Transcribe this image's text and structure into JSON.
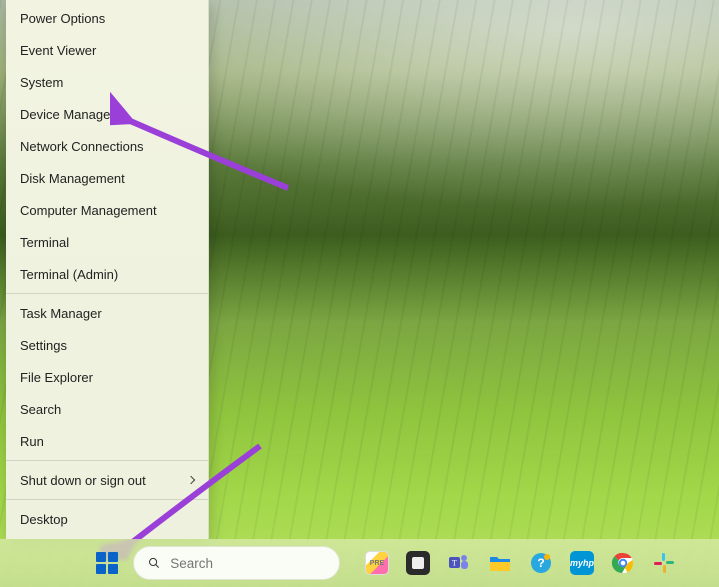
{
  "colors": {
    "accent_purple": "#9b3fd9",
    "start_blue": "#0a63c9"
  },
  "winx_menu": {
    "groups": [
      {
        "items": [
          {
            "key": "power-options",
            "label": "Power Options"
          },
          {
            "key": "event-viewer",
            "label": "Event Viewer"
          },
          {
            "key": "system",
            "label": "System"
          },
          {
            "key": "device-manager",
            "label": "Device Manager"
          },
          {
            "key": "network-connections",
            "label": "Network Connections"
          },
          {
            "key": "disk-management",
            "label": "Disk Management"
          },
          {
            "key": "computer-management",
            "label": "Computer Management"
          },
          {
            "key": "terminal",
            "label": "Terminal"
          },
          {
            "key": "terminal-admin",
            "label": "Terminal (Admin)"
          }
        ]
      },
      {
        "items": [
          {
            "key": "task-manager",
            "label": "Task Manager"
          },
          {
            "key": "settings",
            "label": "Settings"
          },
          {
            "key": "file-explorer",
            "label": "File Explorer"
          },
          {
            "key": "search",
            "label": "Search"
          },
          {
            "key": "run",
            "label": "Run"
          }
        ]
      },
      {
        "items": [
          {
            "key": "shut-down-or-sign-out",
            "label": "Shut down or sign out",
            "submenu": true
          }
        ]
      },
      {
        "items": [
          {
            "key": "desktop",
            "label": "Desktop"
          }
        ]
      }
    ]
  },
  "taskbar": {
    "search_placeholder": "Search",
    "icons": [
      {
        "key": "microsoft-store",
        "name": "microsoft-store-icon"
      },
      {
        "key": "app-dark",
        "name": "app-dark-icon"
      },
      {
        "key": "teams",
        "name": "teams-icon"
      },
      {
        "key": "file-explorer",
        "name": "file-explorer-icon"
      },
      {
        "key": "edge-assist",
        "name": "edge-assist-icon"
      },
      {
        "key": "myhp",
        "name": "myhp-icon",
        "text": "myhp"
      },
      {
        "key": "chrome",
        "name": "chrome-icon"
      },
      {
        "key": "slack",
        "name": "slack-icon"
      }
    ]
  },
  "annotations": {
    "arrow_to": "Device Manager",
    "arrow_from": "Start button"
  }
}
